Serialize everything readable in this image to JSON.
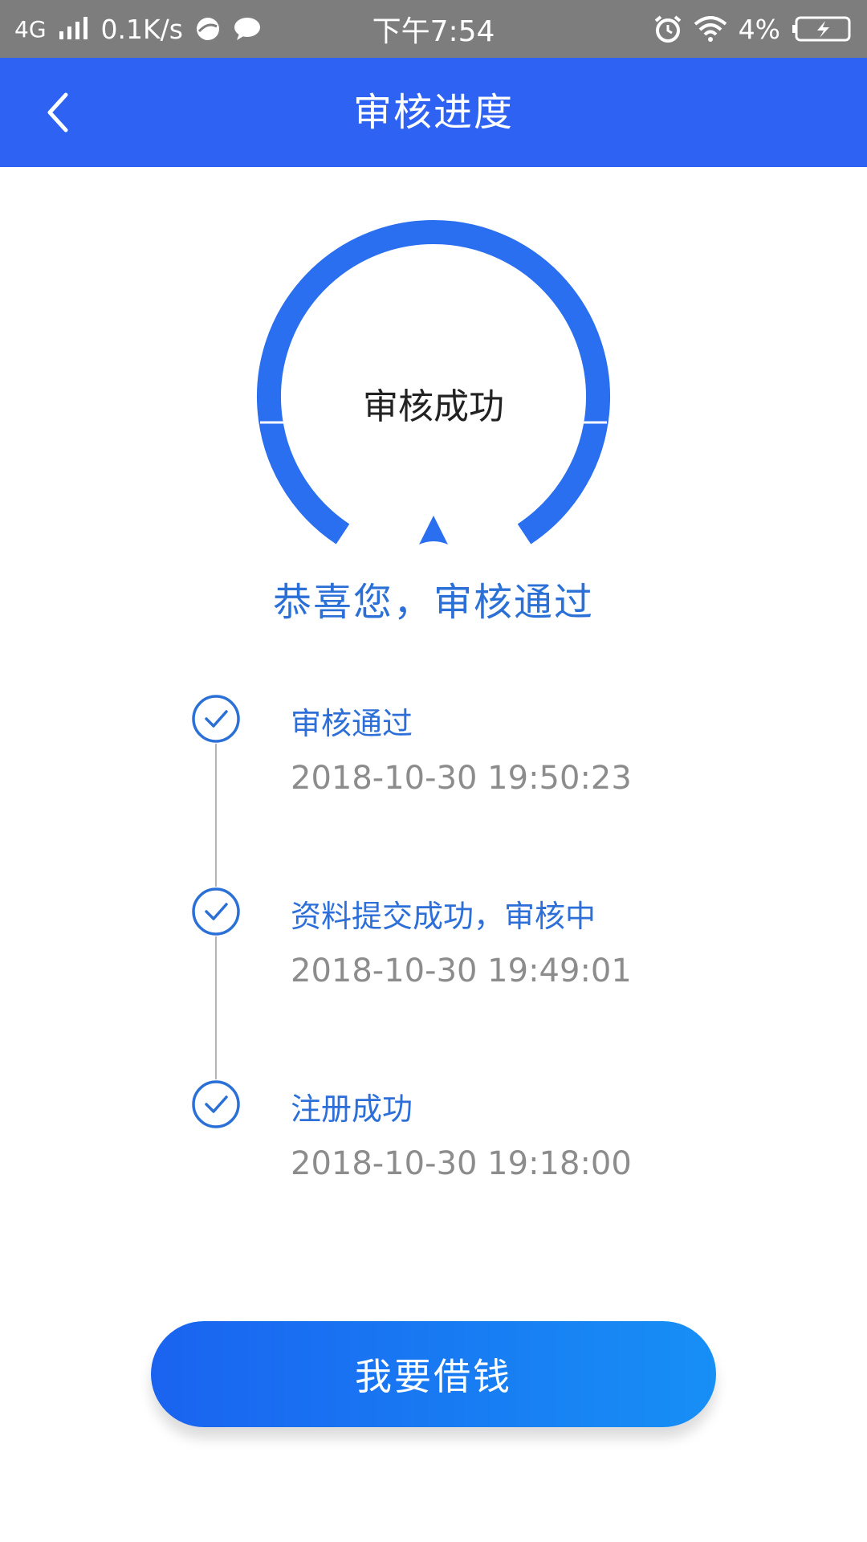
{
  "status_bar": {
    "network": "4G",
    "speed": "0.1K/s",
    "time": "下午7:54",
    "battery": "4%"
  },
  "nav": {
    "title": "审核进度"
  },
  "gauge": {
    "label": "审核成功"
  },
  "congrats": "恭喜您，审核通过",
  "timeline": [
    {
      "title": "审核通过",
      "time": "2018-10-30 19:50:23"
    },
    {
      "title": "资料提交成功，审核中",
      "time": "2018-10-30 19:49:01"
    },
    {
      "title": "注册成功",
      "time": "2018-10-30 19:18:00"
    }
  ],
  "action": {
    "label": "我要借钱"
  },
  "colors": {
    "nav_bg": "#2d62f3",
    "accent": "#2b70d6",
    "arc": "#2a6ff0",
    "status_bg": "#7d7d7d",
    "muted_text": "#8c8c8c"
  }
}
